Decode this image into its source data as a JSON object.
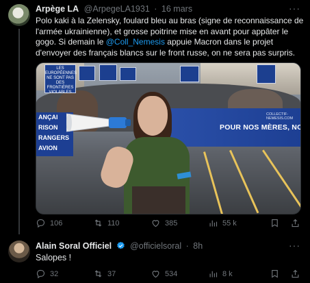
{
  "tweet": {
    "author_name": "Arpège LA",
    "author_handle": "@ArpegeLA1931",
    "separator": "·",
    "time": "16 mars",
    "text_1": "Polo kaki à la Zelensky, foulard bleu au bras (signe de reconnaissance de l'armée ukrainienne), et grosse poitrine mise en avant pour appâter le gogo. Si demain le ",
    "mention": "@Coll_Nemesis",
    "text_2": " appuie Macron dans le projet d'envoyer des français blancs sur le front russe, on ne sera pas surpris.",
    "photo": {
      "banner_right_text": "POUR NOS MÈRES, NOS SOEURS, NO",
      "banner_right_url": "COLLECTIF-NEMESIS.COM",
      "banner_left_lines": [
        "ANÇAI",
        "RISON",
        "RANGERS",
        "AVION"
      ],
      "sign_text": "LES EUROPÉENNES NE SONT PAS DES FRONTIÈRES VIOLABLES"
    },
    "stats": {
      "replies": "106",
      "retweets": "110",
      "likes": "385",
      "views": "55 k"
    }
  },
  "reply": {
    "author_name": "Alain Soral Officiel",
    "author_handle": "@officielsoral",
    "separator": "·",
    "time": "8h",
    "text": "Salopes !",
    "stats": {
      "replies": "32",
      "retweets": "37",
      "likes": "534",
      "views": "8 k"
    }
  },
  "more_label": "···",
  "colors": {
    "accent": "#1d9bf0",
    "muted": "#71767b",
    "background": "#000000"
  },
  "icons": [
    "reply-icon",
    "retweet-icon",
    "like-icon",
    "views-icon",
    "bookmark-icon",
    "share-icon",
    "verified-icon",
    "more-icon"
  ]
}
